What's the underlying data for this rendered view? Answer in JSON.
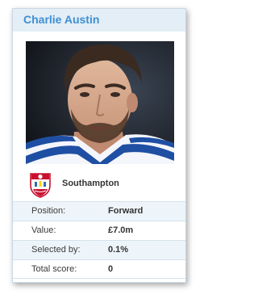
{
  "player": {
    "name": "Charlie Austin",
    "photo_icon": "player-photo",
    "club": {
      "name": "Southampton",
      "crest_icon": "southampton-crest"
    }
  },
  "stats": [
    {
      "label": "Position:",
      "value": "Forward"
    },
    {
      "label": "Value:",
      "value": "£7.0m"
    },
    {
      "label": "Selected by:",
      "value": "0.1%"
    },
    {
      "label": "Total score:",
      "value": "0"
    }
  ],
  "colors": {
    "accent": "#3f8fd2",
    "header_bg": "#e3eef6",
    "row_alt_bg": "#eef5fa",
    "border": "#d4e2ec"
  }
}
